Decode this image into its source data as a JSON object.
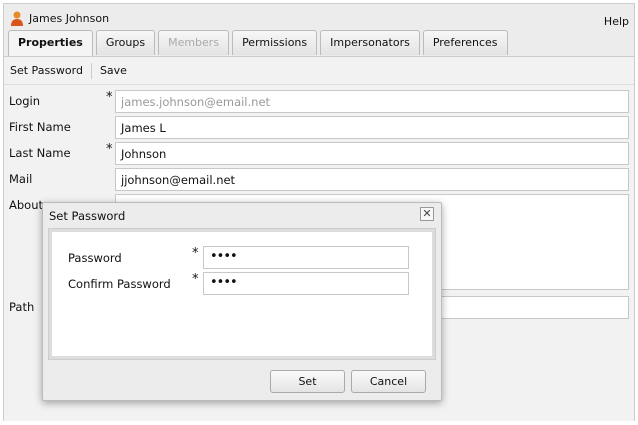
{
  "window": {
    "title": "James Johnson",
    "help": "Help"
  },
  "tabs": [
    {
      "label": "Properties"
    },
    {
      "label": "Groups"
    },
    {
      "label": "Members"
    },
    {
      "label": "Permissions"
    },
    {
      "label": "Impersonators"
    },
    {
      "label": "Preferences"
    }
  ],
  "toolbar": {
    "set_password": "Set Password",
    "save": "Save"
  },
  "form": {
    "login": {
      "label": "Login",
      "value": "james.johnson@email.net",
      "required": "*"
    },
    "first_name": {
      "label": "First Name",
      "value": "James L"
    },
    "last_name": {
      "label": "Last Name",
      "value": "Johnson",
      "required": "*"
    },
    "mail": {
      "label": "Mail",
      "value": "jjohnson@email.net"
    },
    "about": {
      "label": "About",
      "value": ""
    },
    "path": {
      "label": "Path",
      "value": ""
    }
  },
  "dialog": {
    "title": "Set Password",
    "password_label": "Password",
    "password_value": "••••",
    "confirm_label": "Confirm Password",
    "confirm_value": "••••",
    "required": "*",
    "set": "Set",
    "cancel": "Cancel",
    "close": "✕"
  }
}
